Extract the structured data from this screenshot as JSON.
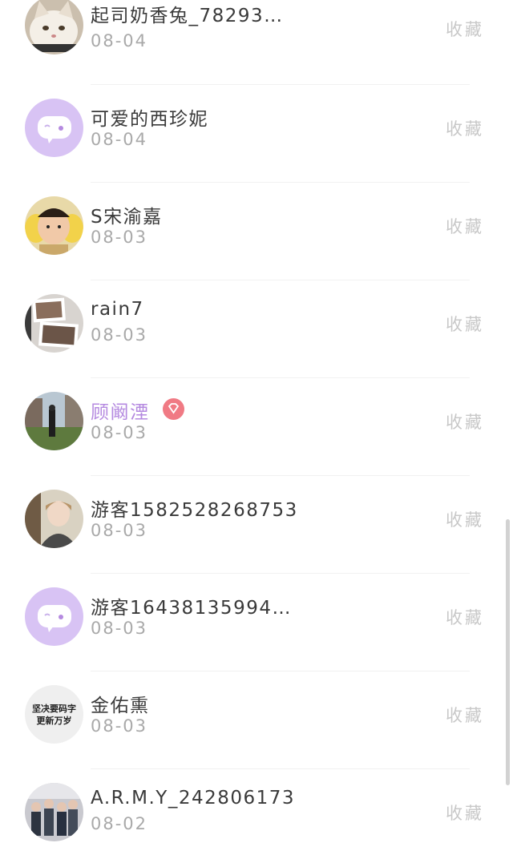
{
  "favorite_label": "收藏",
  "users": [
    {
      "name": "起司奶香兔_78293…",
      "date": "08-04",
      "avatar": "cat-photo",
      "name_style": "normal"
    },
    {
      "name": "可爱的西珍妮",
      "date": "08-04",
      "avatar": "default-chat-bubble",
      "name_style": "normal"
    },
    {
      "name": "S宋渝嘉",
      "date": "08-03",
      "avatar": "child-photo",
      "name_style": "normal"
    },
    {
      "name": "rain7",
      "date": "08-03",
      "avatar": "photo-collage",
      "name_style": "normal"
    },
    {
      "name": "顾阚湮",
      "date": "08-03",
      "avatar": "street-photo",
      "name_style": "vip"
    },
    {
      "name": "游客1582528268753",
      "date": "08-03",
      "avatar": "person-photo",
      "name_style": "normal"
    },
    {
      "name": "游客16438135994…",
      "date": "08-03",
      "avatar": "default-chat-bubble",
      "name_style": "normal"
    },
    {
      "name": "金佑熏",
      "date": "08-03",
      "avatar": "text-sticker",
      "name_style": "normal"
    },
    {
      "name": "A.R.M.Y_242806173",
      "date": "08-02",
      "avatar": "group-photo",
      "name_style": "normal"
    }
  ],
  "sticker_avatar_text": [
    "坚决要码字",
    "更新万岁"
  ],
  "colors": {
    "vip_name": "#b58ae0",
    "default_avatar_bg": "#d8c3f4",
    "vip_badge": "#f07a84"
  }
}
